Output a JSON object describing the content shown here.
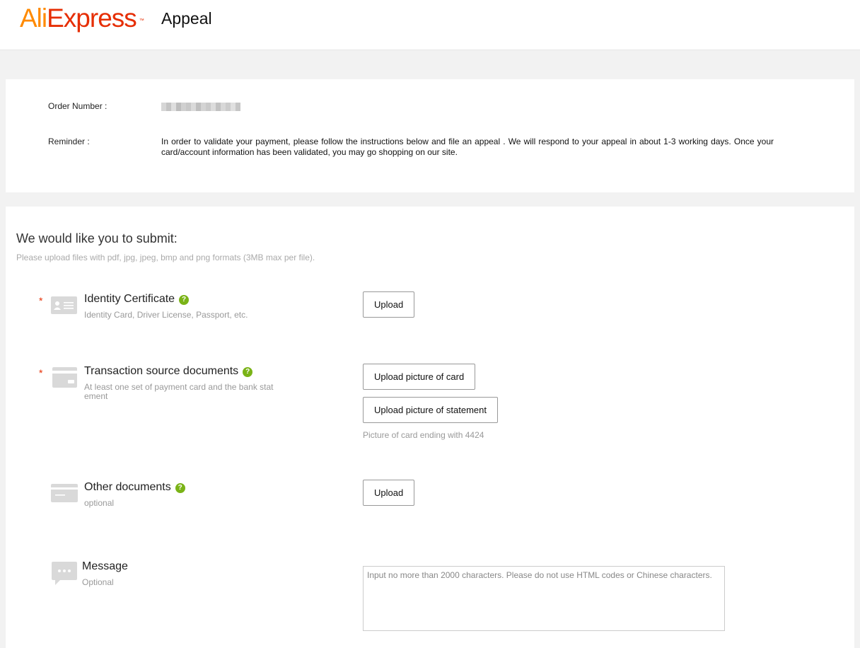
{
  "header": {
    "logo_part1": "Ali",
    "logo_part2": "Express",
    "logo_tm": "™",
    "title": "Appeal"
  },
  "info": {
    "order_label": "Order Number  :",
    "reminder_label": "Reminder   :",
    "reminder_text": "In order to validate your payment, please follow the instructions below and file an appeal . We will respond to your appeal in about 1-3 working days. Once your card/account information has been validated, you may go shopping on our site."
  },
  "submit": {
    "heading": "We would like you to submit:",
    "subheading": "Please upload files with pdf, jpg, jpeg, bmp and png formats (3MB max per file)."
  },
  "documents": [
    {
      "title": "Identity Certificate",
      "description": "Identity Card, Driver License, Passport, etc.",
      "required": true,
      "icon": "id-card-icon",
      "buttons": [
        "Upload"
      ]
    },
    {
      "title": "Transaction source documents",
      "description_line1": "At least one set of payment card and the bank stat",
      "description_line2": "ement",
      "required": true,
      "icon": "payment-card-icon",
      "buttons": [
        "Upload picture of card",
        "Upload picture of statement"
      ],
      "note": "Picture of card ending with 4424"
    },
    {
      "title": "Other documents",
      "description": "optional",
      "required": false,
      "icon": "document-card-icon",
      "buttons": [
        "Upload"
      ]
    }
  ],
  "message": {
    "title": "Message",
    "description": "Optional",
    "icon": "chat-bubble-icon",
    "placeholder": "Input no more than 2000 characters. Please do not use HTML codes or Chinese characters."
  },
  "ui": {
    "required_mark": "*",
    "help_mark": "?"
  },
  "colors": {
    "brand_orange": "#ff8a00",
    "brand_red": "#e62e04",
    "help_green": "#7ab317",
    "page_bg": "#f2f2f2"
  }
}
